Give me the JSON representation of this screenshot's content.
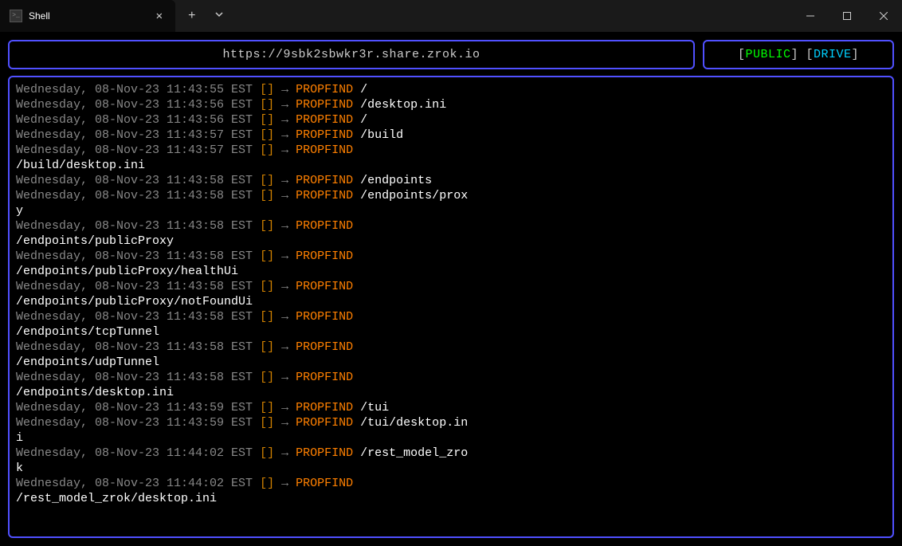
{
  "window": {
    "tab_title": "Shell"
  },
  "header": {
    "url": "https://9sbk2sbwkr3r.share.zrok.io",
    "status_public": "PUBLIC",
    "status_drive": "DRIVE"
  },
  "log": [
    {
      "ts": "Wednesday, 08-Nov-23 11:43:55 EST",
      "method": "PROPFIND",
      "path": "/",
      "wrap": ""
    },
    {
      "ts": "Wednesday, 08-Nov-23 11:43:56 EST",
      "method": "PROPFIND",
      "path": "/desktop.ini",
      "wrap": ""
    },
    {
      "ts": "Wednesday, 08-Nov-23 11:43:56 EST",
      "method": "PROPFIND",
      "path": "/",
      "wrap": ""
    },
    {
      "ts": "Wednesday, 08-Nov-23 11:43:57 EST",
      "method": "PROPFIND",
      "path": "/build",
      "wrap": ""
    },
    {
      "ts": "Wednesday, 08-Nov-23 11:43:57 EST",
      "method": "PROPFIND",
      "path": "",
      "wrap": "/build/desktop.ini"
    },
    {
      "ts": "Wednesday, 08-Nov-23 11:43:58 EST",
      "method": "PROPFIND",
      "path": "/endpoints",
      "wrap": ""
    },
    {
      "ts": "Wednesday, 08-Nov-23 11:43:58 EST",
      "method": "PROPFIND",
      "path": "/endpoints/prox",
      "wrap": "y"
    },
    {
      "ts": "Wednesday, 08-Nov-23 11:43:58 EST",
      "method": "PROPFIND",
      "path": "",
      "wrap": "/endpoints/publicProxy"
    },
    {
      "ts": "Wednesday, 08-Nov-23 11:43:58 EST",
      "method": "PROPFIND",
      "path": "",
      "wrap": "/endpoints/publicProxy/healthUi"
    },
    {
      "ts": "Wednesday, 08-Nov-23 11:43:58 EST",
      "method": "PROPFIND",
      "path": "",
      "wrap": "/endpoints/publicProxy/notFoundUi"
    },
    {
      "ts": "Wednesday, 08-Nov-23 11:43:58 EST",
      "method": "PROPFIND",
      "path": "",
      "wrap": "/endpoints/tcpTunnel"
    },
    {
      "ts": "Wednesday, 08-Nov-23 11:43:58 EST",
      "method": "PROPFIND",
      "path": "",
      "wrap": "/endpoints/udpTunnel"
    },
    {
      "ts": "Wednesday, 08-Nov-23 11:43:58 EST",
      "method": "PROPFIND",
      "path": "",
      "wrap": "/endpoints/desktop.ini"
    },
    {
      "ts": "Wednesday, 08-Nov-23 11:43:59 EST",
      "method": "PROPFIND",
      "path": "/tui",
      "wrap": ""
    },
    {
      "ts": "Wednesday, 08-Nov-23 11:43:59 EST",
      "method": "PROPFIND",
      "path": "/tui/desktop.in",
      "wrap": "i"
    },
    {
      "ts": "Wednesday, 08-Nov-23 11:44:02 EST",
      "method": "PROPFIND",
      "path": "/rest_model_zro",
      "wrap": "k"
    },
    {
      "ts": "Wednesday, 08-Nov-23 11:44:02 EST",
      "method": "PROPFIND",
      "path": "",
      "wrap": "/rest_model_zrok/desktop.ini"
    }
  ]
}
